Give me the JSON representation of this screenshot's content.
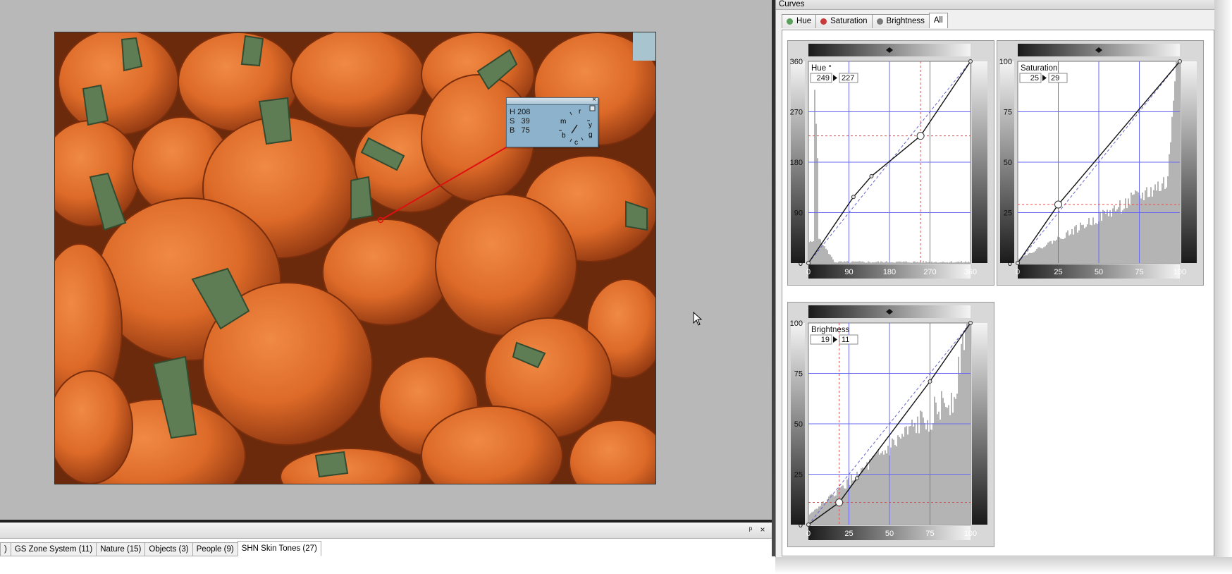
{
  "workspace": {
    "info_box": {
      "close": "×",
      "h": "H 208",
      "s": "S   39",
      "b": "B   75",
      "wheel_letters": [
        "r",
        "y",
        "g",
        "c",
        "b",
        "m"
      ],
      "pin": "□"
    }
  },
  "preset_bar": {
    "pin": "ᵖ",
    "close": "×",
    "tabs": [
      {
        "label": ")"
      },
      {
        "label": "GS Zone System (11)"
      },
      {
        "label": "Nature (15)"
      },
      {
        "label": "Objects (3)"
      },
      {
        "label": "People (9)"
      },
      {
        "label": "SHN Skin Tones (27)",
        "active": true
      }
    ]
  },
  "curves_panel": {
    "title": "Curves",
    "tabs": [
      {
        "label": "Hue",
        "dot": "#5aa05a"
      },
      {
        "label": "Saturation",
        "dot": "#c83a3a"
      },
      {
        "label": "Brightness",
        "dot": "#7a7a7a"
      },
      {
        "label": "All",
        "active": true
      }
    ]
  },
  "chart_data": [
    {
      "type": "line",
      "title": "Hue °",
      "readout_in": "249",
      "readout_out": "227",
      "xlim": [
        0,
        360
      ],
      "ylim": [
        0,
        360
      ],
      "xticks": [
        0,
        90,
        180,
        270,
        360
      ],
      "yticks": [
        0,
        90,
        180,
        270,
        360
      ],
      "curve_points": [
        [
          0,
          0
        ],
        [
          100,
          118
        ],
        [
          140,
          155
        ],
        [
          249,
          227
        ],
        [
          360,
          360
        ]
      ],
      "marker": [
        249,
        227
      ],
      "colors": {
        "grid": "#6a6af0",
        "marker": "#e05050",
        "histogram": "#b4b4b4"
      }
    },
    {
      "type": "line",
      "title": "Saturation",
      "readout_in": "25",
      "readout_out": "29",
      "xlim": [
        0,
        100
      ],
      "ylim": [
        0,
        100
      ],
      "xticks": [
        0,
        25,
        50,
        75,
        100
      ],
      "yticks": [
        0,
        25,
        50,
        75,
        100
      ],
      "curve_points": [
        [
          0,
          0
        ],
        [
          25,
          29
        ],
        [
          100,
          100
        ]
      ],
      "marker": [
        25,
        29
      ],
      "colors": {
        "grid": "#6a6af0",
        "marker": "#e05050",
        "histogram": "#b4b4b4"
      }
    },
    {
      "type": "line",
      "title": "Brightness",
      "readout_in": "19",
      "readout_out": "11",
      "xlim": [
        0,
        100
      ],
      "ylim": [
        0,
        100
      ],
      "xticks": [
        0,
        25,
        50,
        75,
        100
      ],
      "yticks": [
        0,
        25,
        50,
        75,
        100
      ],
      "curve_points": [
        [
          0,
          0
        ],
        [
          19,
          11
        ],
        [
          30,
          23
        ],
        [
          75,
          71
        ],
        [
          100,
          100
        ]
      ],
      "marker": [
        19,
        11
      ],
      "colors": {
        "grid": "#6a6af0",
        "marker": "#e05050",
        "histogram": "#b4b4b4"
      }
    }
  ]
}
